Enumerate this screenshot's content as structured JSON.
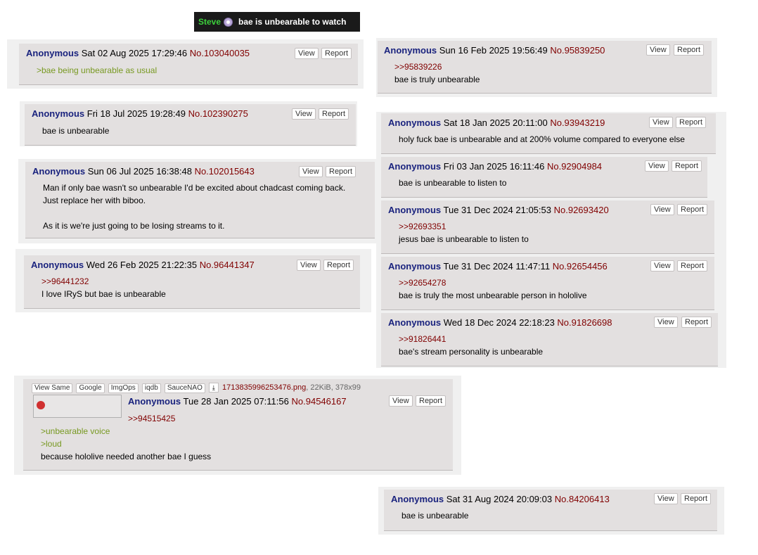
{
  "title_bar": {
    "user": "Steve",
    "title": "bae is unbearable to watch"
  },
  "posts": [
    {
      "name": "Anonymous",
      "date": "Sat 02 Aug 2025 17:29:46",
      "no": "No.103040035",
      "view": "View",
      "report": "Report",
      "lines": [
        ">bae being unbearable as usual"
      ]
    },
    {
      "name": "Anonymous",
      "date": "Fri 18 Jul 2025 19:28:49",
      "no": "No.102390275",
      "view": "View",
      "report": "Report",
      "lines": [
        "bae is unbearable"
      ]
    },
    {
      "name": "Anonymous",
      "date": "Sun 06 Jul 2025 16:38:48",
      "no": "No.102015643",
      "view": "View",
      "report": "Report",
      "lines": [
        "Man if only bae wasn't so unbearable I'd be excited about chadcast coming back.",
        "Just replace her with biboo.",
        "",
        "As it is we're just going to be losing streams to it."
      ]
    },
    {
      "name": "Anonymous",
      "date": "Wed 26 Feb 2025 21:22:35",
      "no": "No.96441347",
      "view": "View",
      "report": "Report",
      "lines": [
        ">>96441232",
        "I love IRyS but bae is unbearable"
      ]
    },
    {
      "name": "Anonymous",
      "date": "Tue 28 Jan 2025 07:11:56",
      "no": "No.94546167",
      "view": "View",
      "report": "Report",
      "lines": [
        ">>94515425"
      ],
      "lines2": [
        ">unbearable voice",
        ">loud",
        "because hololive needed another bae I guess"
      ],
      "file": {
        "buttons": [
          "View Same",
          "Google",
          "ImgOps",
          "iqdb",
          "SauceNAO"
        ],
        "filename": "1713835996253476.png",
        "meta": ", 22KiB, 378x99"
      }
    },
    {
      "name": "Anonymous",
      "date": "Sun 16 Feb 2025 19:56:49",
      "no": "No.95839250",
      "view": "View",
      "report": "Report",
      "lines": [
        ">>95839226",
        "bae is truly unbearable"
      ]
    },
    {
      "name": "Anonymous",
      "date": "Sat 18 Jan 2025 20:11:00",
      "no": "No.93943219",
      "view": "View",
      "report": "Report",
      "lines": [
        "holy fuck bae is unbearable and at 200% volume compared to everyone else"
      ]
    },
    {
      "name": "Anonymous",
      "date": "Fri 03 Jan 2025 16:11:46",
      "no": "No.92904984",
      "view": "View",
      "report": "Report",
      "lines": [
        "bae is unbearable to listen to"
      ]
    },
    {
      "name": "Anonymous",
      "date": "Tue 31 Dec 2024 21:05:53",
      "no": "No.92693420",
      "view": "View",
      "report": "Report",
      "lines": [
        ">>92693351",
        "jesus bae is unbearable to listen to"
      ]
    },
    {
      "name": "Anonymous",
      "date": "Tue 31 Dec 2024 11:47:11",
      "no": "No.92654456",
      "view": "View",
      "report": "Report",
      "lines": [
        ">>92654278",
        "bae is truly the most unbearable person in hololive"
      ]
    },
    {
      "name": "Anonymous",
      "date": "Wed 18 Dec 2024 22:18:23",
      "no": "No.91826698",
      "view": "View",
      "report": "Report",
      "lines": [
        ">>91826441",
        "bae's stream personality is unbearable"
      ]
    },
    {
      "name": "Anonymous",
      "date": "Sat 31 Aug 2024 20:09:03",
      "no": "No.84206413",
      "view": "View",
      "report": "Report",
      "lines": [
        "bae is unbearable"
      ]
    }
  ]
}
